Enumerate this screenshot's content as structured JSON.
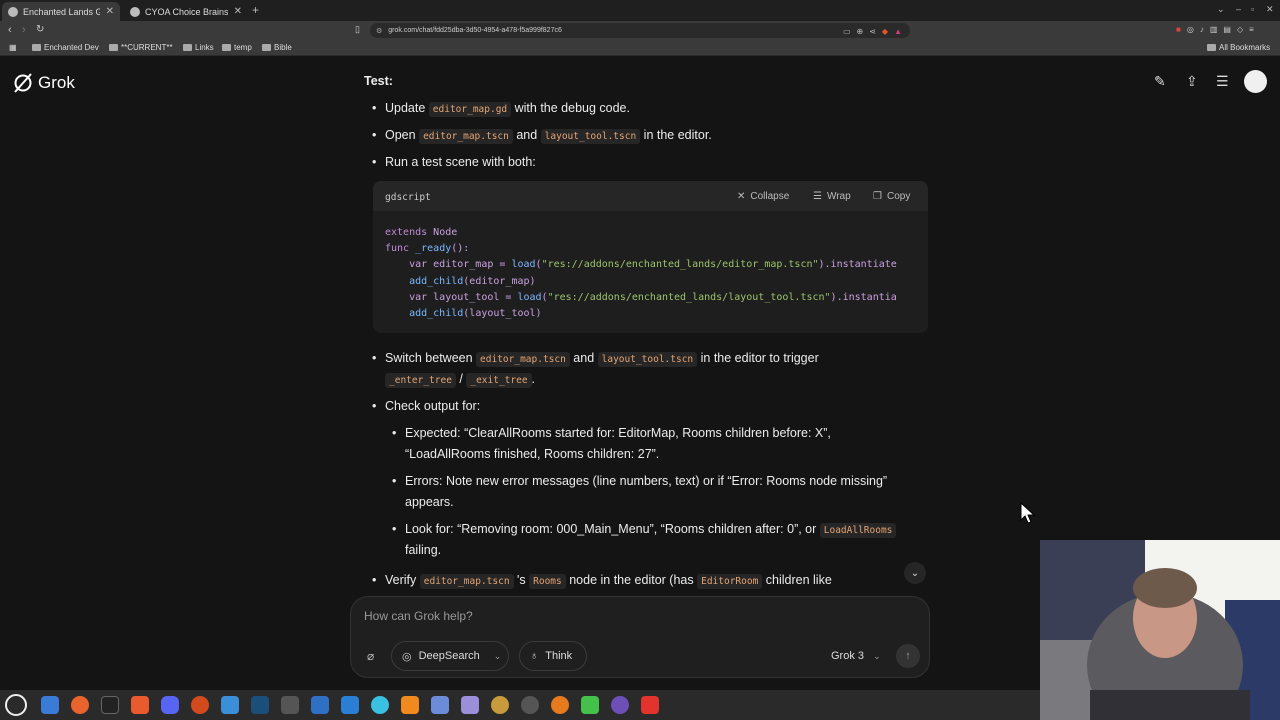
{
  "browser": {
    "tabs": [
      {
        "title": "Enchanted Lands Gam",
        "active": true
      },
      {
        "title": "CYOA Choice Brainstormi",
        "active": false
      }
    ],
    "url": "grok.com/chat/fdd25dba-3d50-4954-a478-f5a999f827c6",
    "bookmarks": [
      "Enchanted Dev",
      "**CURRENT**",
      "Links",
      "temp",
      "Bible"
    ],
    "all_bookmarks": "All Bookmarks"
  },
  "app": {
    "name": "Grok"
  },
  "message": {
    "test_heading": "Test:",
    "b1_pre": "Update ",
    "b1_code": "editor_map.gd",
    "b1_post": " with the debug code.",
    "b2_pre": "Open ",
    "b2_code1": "editor_map.tscn",
    "b2_mid": " and ",
    "b2_code2": "layout_tool.tscn",
    "b2_post": " in the editor.",
    "b3": "Run a test scene with both:",
    "code": {
      "lang": "gdscript",
      "collapse": "Collapse",
      "wrap": "Wrap",
      "copy": "Copy",
      "l1_kw": "extends",
      "l1_rest": " Node",
      "l2_kw": "func",
      "l2_fn": " _ready",
      "l2_rest": "():",
      "l3_a": "    var editor_map = ",
      "l3_fn": "load",
      "l3_b": "(",
      "l3_str": "\"res://addons/enchanted_lands/editor_map.tscn\"",
      "l3_c": ").instantiate",
      "l4_fn": "    add_child",
      "l4_rest": "(editor_map)",
      "l5_a": "    var layout_tool = ",
      "l5_fn": "load",
      "l5_b": "(",
      "l5_str": "\"res://addons/enchanted_lands/layout_tool.tscn\"",
      "l5_c": ").instantia",
      "l6_fn": "    add_child",
      "l6_rest": "(layout_tool)"
    },
    "b4_pre": "Switch between ",
    "b4_code1": "editor_map.tscn",
    "b4_mid": " and ",
    "b4_code2": "layout_tool.tscn",
    "b4_post": " in the editor to trigger",
    "b4_code3": "_enter_tree",
    "b4_sep": " / ",
    "b4_code4": "_exit_tree",
    "b4_end": ".",
    "b5": "Check output for:",
    "s1_l1": "Expected: “ClearAllRooms started for: EditorMap, Rooms children before: X”,",
    "s1_l2": "“LoadAllRooms finished, Rooms children: 27”.",
    "s2_l1": "Errors: Note new error messages (line numbers, text) or if “Error: Rooms node missing”",
    "s2_l2": "appears.",
    "s3_pre": "Look for: “Removing room: 000_Main_Menu”, “Rooms children after: 0”, or ",
    "s3_code": "LoadAllRooms",
    "s3_l2": "failing.",
    "b6_pre": "Verify ",
    "b6_code1": "editor_map.tscn",
    "b6_mid1": " 's ",
    "b6_code2": "Rooms",
    "b6_mid2": " node in the editor (has ",
    "b6_code3": "EditorRoom",
    "b6_post": " children like"
  },
  "composer": {
    "placeholder": "How can Grok help?",
    "deepsearch": "DeepSearch",
    "think": "Think",
    "model": "Grok 3"
  }
}
